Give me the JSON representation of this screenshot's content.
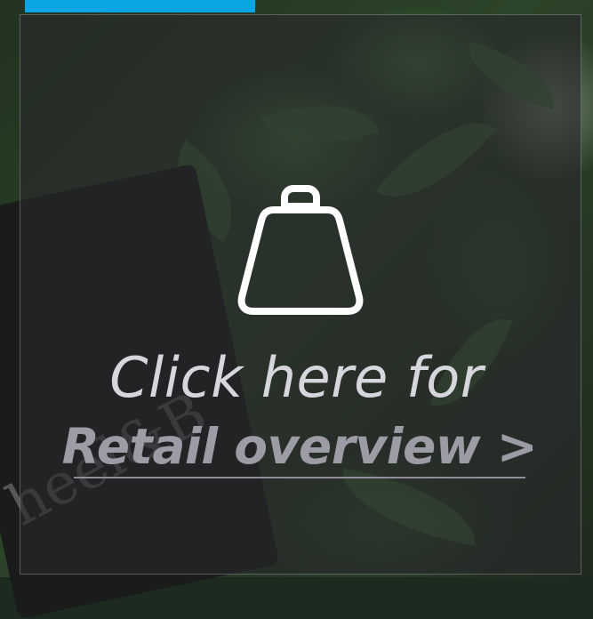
{
  "promo": {
    "line1": "Click here for",
    "link_text": "Retail overview >",
    "icon": "shopping-bag-icon",
    "accent_color": "#0aa5e4",
    "overlay_color": "#28282c"
  }
}
